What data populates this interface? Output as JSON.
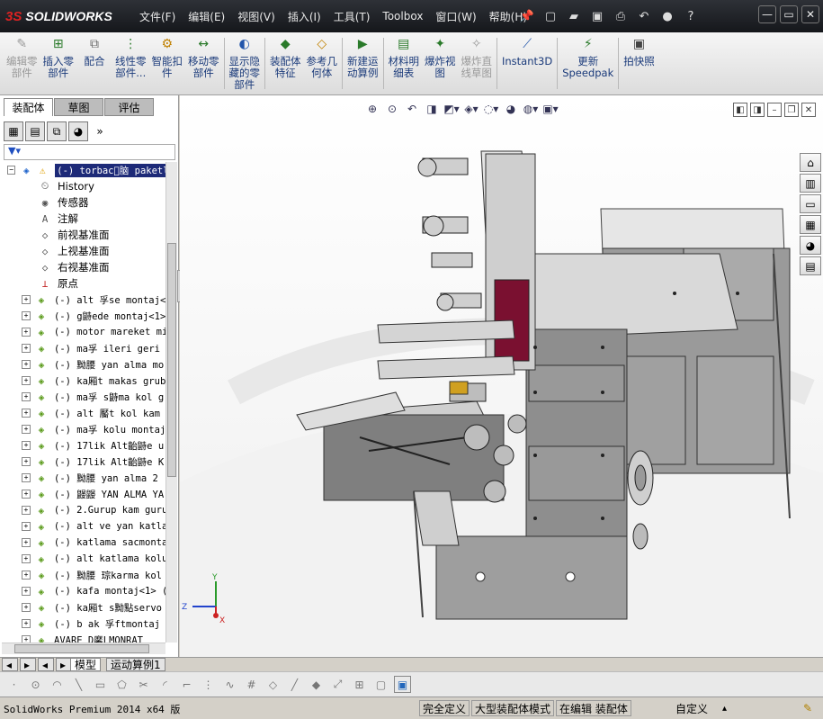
{
  "app": {
    "logo_prefix": "3S",
    "logo_text": "SOLIDWORKS",
    "menus": [
      "文件(F)",
      "编辑(E)",
      "视图(V)",
      "插入(I)",
      "工具(T)",
      "Toolbox",
      "窗口(W)",
      "帮助(H)"
    ],
    "quick_icons": [
      "pin-icon",
      "new-document-icon",
      "open-icon",
      "save-icon",
      "print-icon",
      "undo-icon",
      "rebuild-icon",
      "help-icon"
    ],
    "window_controls": [
      "—",
      "▭",
      "✕"
    ]
  },
  "ribbon": {
    "items": [
      {
        "label": "编辑零\n部件",
        "icon": "edit-component-icon",
        "disabled": true
      },
      {
        "label": "插入零\n部件",
        "icon": "insert-component-icon",
        "disabled": false
      },
      {
        "label": "配合",
        "icon": "mate-icon",
        "disabled": false
      },
      {
        "label": "线性零\n部件...",
        "icon": "linear-pattern-icon",
        "disabled": false
      },
      {
        "label": "智能扣\n件",
        "icon": "smart-fasteners-icon",
        "disabled": false
      },
      {
        "label": "移动零\n部件",
        "icon": "move-component-icon",
        "disabled": false
      },
      {
        "label": "显示隐\n藏的零\n部件",
        "icon": "show-hidden-icon",
        "disabled": false
      },
      {
        "label": "装配体\n特征",
        "icon": "assembly-features-icon",
        "disabled": false
      },
      {
        "label": "参考几\n何体",
        "icon": "reference-geometry-icon",
        "disabled": false
      },
      {
        "label": "新建运\n动算例",
        "icon": "new-motion-study-icon",
        "disabled": false
      },
      {
        "label": "材料明\n细表",
        "icon": "bill-of-materials-icon",
        "disabled": false
      },
      {
        "label": "爆炸视\n图",
        "icon": "exploded-view-icon",
        "disabled": false
      },
      {
        "label": "爆炸直\n线草图",
        "icon": "explode-line-sketch-icon",
        "disabled": true
      },
      {
        "label": "Instant3D",
        "icon": "instant3d-icon",
        "disabled": false
      },
      {
        "label": "更新\nSpeedpak",
        "icon": "speedpak-icon",
        "disabled": false
      },
      {
        "label": "拍快照",
        "icon": "snapshot-icon",
        "disabled": false
      }
    ]
  },
  "panel": {
    "tabs": [
      "装配体",
      "草图",
      "评估"
    ],
    "active_tab": 0,
    "root": "(-) torbac\u0000脑 paketle",
    "features": [
      {
        "label": "History",
        "icon": "history-icon"
      },
      {
        "label": "传感器",
        "icon": "sensors-icon"
      },
      {
        "label": "注解",
        "icon": "annotations-icon"
      },
      {
        "label": "前视基准面",
        "icon": "plane-icon"
      },
      {
        "label": "上视基准面",
        "icon": "plane-icon"
      },
      {
        "label": "右视基准面",
        "icon": "plane-icon"
      },
      {
        "label": "原点",
        "icon": "origin-icon"
      }
    ],
    "components": [
      "(-) alt 孚se montaj<",
      "(-) g鼭ede montaj<1>",
      "(-) motor mareket mi",
      "(-) ma孚 ileri geri",
      "(-) 黝腰 yan alma mo",
      "(-) ka厢t makas grub",
      "(-) ma孚 s鼭ma kol g",
      "(-) alt 靨t kol kam",
      "(-) ma孚 kolu montaj",
      "(-) 17lik Alt齝鼭e u",
      "(-) 17lik Alt齝鼭e K",
      "(-) 黝腰 yan alma 2",
      "(-) 鼹鼹 YAN ALMA YA",
      "(-) 2.Gurup kam guru",
      "(-) alt ve yan katla",
      "(-) katlama sacmonta",
      "(-) alt katlama kolu",
      "(-) 黝腰 琮karma kol",
      "(-) kafa montaj<1> (",
      "(-) ka厢t s黝點servo",
      "(-) b  ak 孚ftmontaj",
      "AVARE D黁LMONRAT"
    ]
  },
  "bottom_tabs": [
    "模型",
    "运动算例1"
  ],
  "status": {
    "left": "SolidWorks Premium 2014 x64 版",
    "fields": [
      "完全定义",
      "大型装配体模式",
      "在编辑 装配体",
      "自定义"
    ]
  },
  "colors": {
    "titlebar": "#1f2125",
    "selection": "#1d2a78",
    "machine_gray": "#8c8c8c",
    "accent_red": "#7a1030"
  }
}
